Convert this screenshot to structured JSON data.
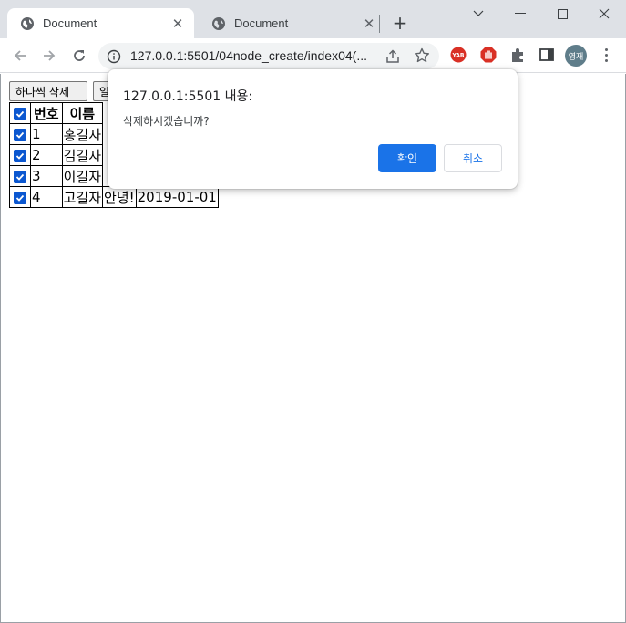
{
  "browser": {
    "tabs": [
      {
        "title": "Document",
        "active": true
      },
      {
        "title": "Document",
        "active": false
      }
    ],
    "address": {
      "url": "127.0.0.1:5501/04node_create/index04(..."
    },
    "extensions": {
      "yab_label": "YAB",
      "profile_label": "영재"
    }
  },
  "page": {
    "buttons": {
      "delete_one": "하나씩 삭제",
      "delete_all_partial": "일"
    },
    "table": {
      "headers": [
        "번호",
        "이름"
      ],
      "rows": [
        {
          "num": "1",
          "name": "홍길자",
          "msg": "",
          "date": ""
        },
        {
          "num": "2",
          "name": "김길자",
          "msg": "",
          "date": ""
        },
        {
          "num": "3",
          "name": "이길자",
          "msg": "",
          "date": ""
        },
        {
          "num": "4",
          "name": "고길자",
          "msg": "안녕!",
          "date": "2019-01-01"
        }
      ]
    }
  },
  "dialog": {
    "title": "127.0.0.1:5501 내용:",
    "message": "삭제하시겠습니까?",
    "ok_label": "확인",
    "cancel_label": "취소"
  },
  "colors": {
    "accent": "#1a73e8",
    "checkbox": "#0b57d0",
    "titlebar": "#dee1e6"
  }
}
